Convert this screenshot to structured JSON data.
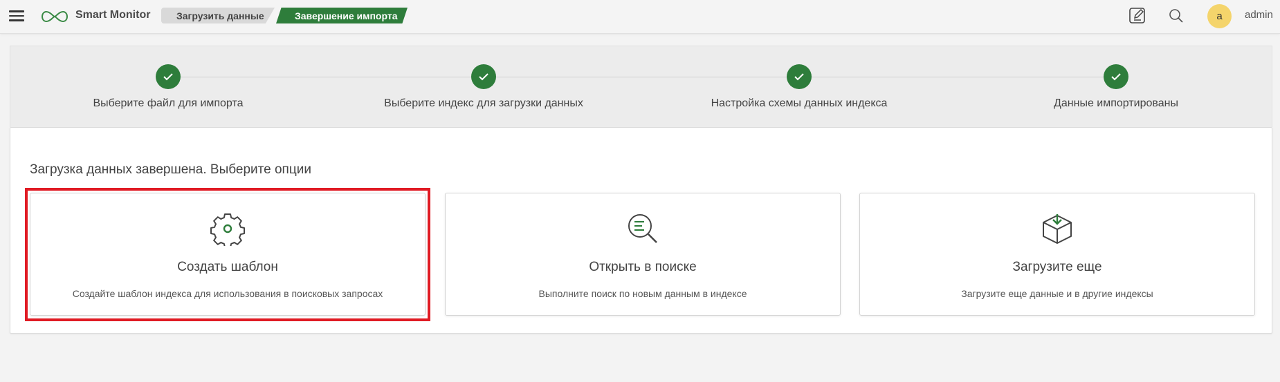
{
  "header": {
    "app_title": "Smart Monitor",
    "breadcrumbs": [
      "Загрузить данные",
      "Завершение импорта"
    ],
    "avatar_letter": "a",
    "username": "admin",
    "icons": [
      "menu-icon",
      "logo-infinity-icon",
      "edit-icon",
      "search-icon"
    ]
  },
  "steps": [
    {
      "label": "Выберите файл для импорта",
      "status": "done"
    },
    {
      "label": "Выберите индекс для загрузки данных",
      "status": "done"
    },
    {
      "label": "Настройка схемы данных индекса",
      "status": "done"
    },
    {
      "label": "Данные импортированы",
      "status": "done"
    }
  ],
  "main": {
    "title": "Загрузка данных завершена. Выберите опции",
    "options": [
      {
        "title": "Создать шаблон",
        "desc": "Создайте шаблон индекса для использования в поисковых запросах",
        "icon": "gear-icon"
      },
      {
        "title": "Открыть в поиске",
        "desc": "Выполните поиск по новым данным в индексе",
        "icon": "search-list-icon"
      },
      {
        "title": "Загрузите еще",
        "desc": "Загрузите еще данные и в другие индексы",
        "icon": "box-download-icon"
      }
    ]
  },
  "colors": {
    "accent": "#2e7d3b",
    "highlight": "#e01b24",
    "avatar": "#f4d46b"
  }
}
